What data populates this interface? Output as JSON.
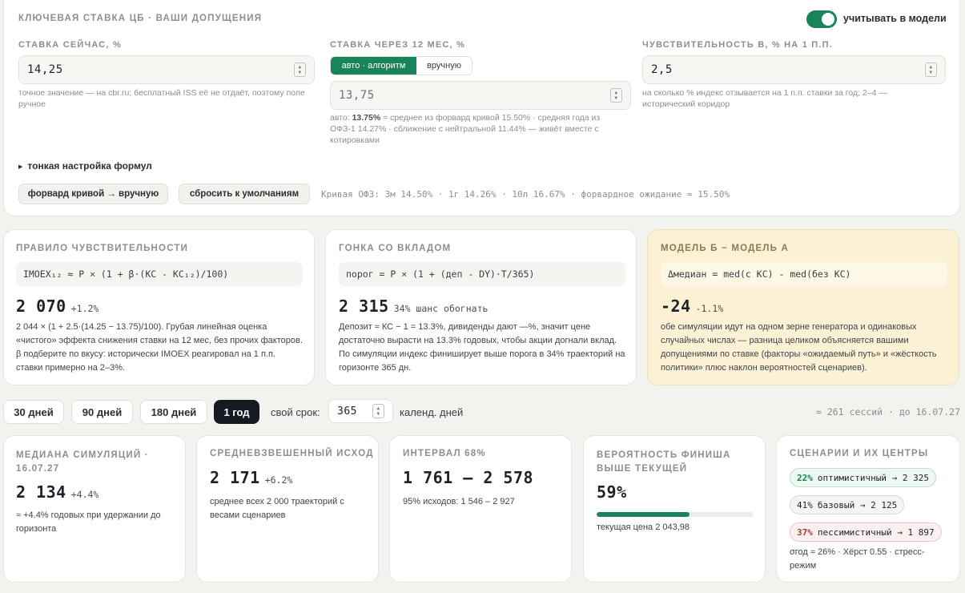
{
  "settings": {
    "title": "КЛЮЧЕВАЯ СТАВКА ЦБ · ВАШИ ДОПУЩЕНИЯ",
    "toggle_label": "учитывать в модели",
    "rate_now": {
      "label": "СТАВКА СЕЙЧАС, %",
      "value": "14,25",
      "hint": "точное значение — на cbr.ru; бесплатный ISS её не отдаёт, поэтому поле ручное"
    },
    "rate_12m": {
      "label": "СТАВКА ЧЕРЕЗ 12 МЕС, %",
      "mode_auto": "авто · алгоритм",
      "mode_manual": "вручную",
      "value": "13,75",
      "hint_prefix": "авто: ",
      "hint_value": "13.75%",
      "hint_rest": " = среднее из форвард кривой 15.50% · средняя года из ОФЗ-1 14.27% · сближение с нейтральной 11.44% — живёт вместе с котировками"
    },
    "sensitivity": {
      "label": "ЧУВСТВИТЕЛЬНОСТЬ β, % НА 1 П.П.",
      "value": "2,5",
      "hint": "на сколько % индекс отзывается на 1 п.п. ставки за год; 2–4 — исторический коридор"
    },
    "fine_tune": "тонкая настройка формул",
    "btn_forward": "форвард кривой → вручную",
    "btn_reset": "сбросить к умолчаниям",
    "curve_info": "Кривая ОФЗ: 3м 14.50% · 1г 14.26% · 10л 16.67% · форвардное ожидание ≈ 15.50%"
  },
  "rule": {
    "title": "ПРАВИЛО ЧУВСТВИТЕЛЬНОСТИ",
    "formula": "IMOEX₁₂ ≈ P × (1 + β·(КС - КС₁₂)/100)",
    "value": "2 070",
    "delta": "+1.2%",
    "desc": "2 044 × (1 + 2.5·(14.25 − 13.75)/100). Грубая линейная оценка «чистого» эффекта снижения ставки на 12 мес, без прочих факторов. β подберите по вкусу: исторически IMOEX реагировал на 1 п.п. ставки примерно на 2–3%."
  },
  "deposit": {
    "title": "ГОНКА СО ВКЛАДОМ",
    "formula": "порог = P × (1 + (деп - DY)·T/365)",
    "value": "2 315",
    "delta": "34% шанс обогнать",
    "desc": "Депозит ≈ КС − 1 = 13.3%, дивиденды дают —%, значит цене достаточно вырасти на 13.3% годовых, чтобы акции догнали вклад. По симуляции индекс финиширует выше порога в 34% траекторий на горизонте 365 дн."
  },
  "model_diff": {
    "title": "МОДЕЛЬ Б − МОДЕЛЬ А",
    "formula": "Δмедиан = med(с КС) - med(без КС)",
    "value": "-24",
    "delta": "-1.1%",
    "desc": "обе симуляции идут на одном зерне генератора и одинаковых случайных числах — разница целиком объясняется вашими допущениями по ставке (факторы «ожидаемый путь» и «жёсткость политики» плюс наклон вероятностей сценариев)."
  },
  "horizon": {
    "options": [
      "30 дней",
      "90 дней",
      "180 дней",
      "1 год"
    ],
    "active": "1 год",
    "custom_label": "свой срок:",
    "custom_value": "365",
    "custom_unit": "календ. дней",
    "sessions": "≈ 261 сессий · до 16.07.27"
  },
  "stats": {
    "median": {
      "title": "МЕДИАНА СИМУЛЯЦИЙ · 16.07.27",
      "value": "2 134",
      "delta": "+4.4%",
      "desc": "≈ +4.4% годовых при удержании до горизонта"
    },
    "weighted": {
      "title": "СРЕДНЕВЗВЕШЕННЫЙ ИСХОД",
      "value": "2 171",
      "delta": "+6.2%",
      "desc": "среднее всех 2 000 траекторий с весами сценариев"
    },
    "interval": {
      "title": "ИНТЕРВАЛ 68%",
      "value": "1 761 – 2 578",
      "desc": "95% исходов: 1 546 – 2 927"
    },
    "prob": {
      "title": "ВЕРОЯТНОСТЬ ФИНИША ВЫШЕ ТЕКУЩЕЙ",
      "value": "59%",
      "progress": 0.59,
      "desc": "текущая цена 2 043,98"
    },
    "scenarios": {
      "title": "СЦЕНАРИИ И ИХ ЦЕНТРЫ",
      "items": [
        {
          "pct": "22%",
          "text": "оптимистичный → 2 325",
          "kind": "opt"
        },
        {
          "pct": "41%",
          "text": "базовый → 2 125",
          "kind": "base"
        },
        {
          "pct": "37%",
          "text": "пессимистичный → 1 897",
          "kind": "pess"
        }
      ],
      "footer": "σгод ≈ 26% · Хёрст 0.55 · стресс-режим"
    }
  },
  "colors": {
    "accent_green": "#17845a",
    "model_bg": "#fcf1d5",
    "opt_bg": "#eef7f1",
    "pess_bg": "#fbf0f0"
  }
}
